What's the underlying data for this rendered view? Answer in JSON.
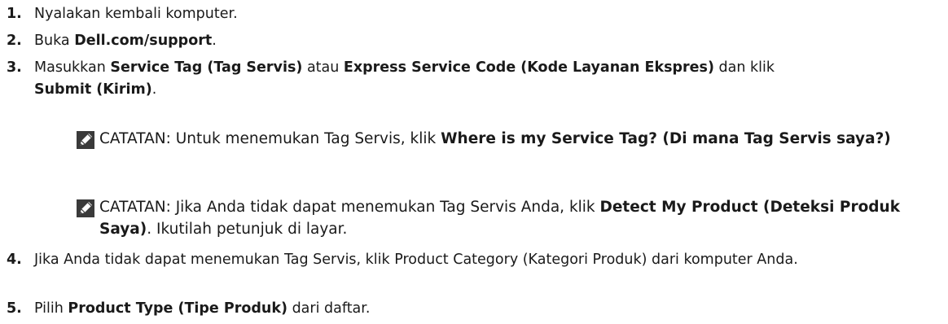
{
  "steps": [
    {
      "num": "1.",
      "parts": [
        {
          "t": "Nyalakan kembali komputer.",
          "b": false
        }
      ]
    },
    {
      "num": "2.",
      "parts": [
        {
          "t": "Buka ",
          "b": false
        },
        {
          "t": "Dell.com/support",
          "b": true
        },
        {
          "t": ".",
          "b": false
        }
      ]
    },
    {
      "num": "3.",
      "parts": [
        {
          "t": "Masukkan ",
          "b": false
        },
        {
          "t": "Service Tag (Tag Servis)",
          "b": true
        },
        {
          "t": " atau ",
          "b": false
        },
        {
          "t": "Express Service Code (Kode Layanan Ekspres)",
          "b": true
        },
        {
          "t": " dan klik ",
          "b": false
        },
        {
          "t": "Submit (Kirim)",
          "b": true
        },
        {
          "t": ".",
          "b": false
        }
      ]
    },
    {
      "num": "4.",
      "parts": [
        {
          "t": "Jika Anda tidak dapat menemukan Tag Servis, klik Product Category (Kategori Produk) dari komputer Anda.",
          "b": false
        }
      ]
    },
    {
      "num": "5.",
      "parts": [
        {
          "t": "Pilih ",
          "b": false
        },
        {
          "t": "Product Type (Tipe Produk)",
          "b": true
        },
        {
          "t": " dari daftar.",
          "b": false
        }
      ]
    }
  ],
  "notes": [
    {
      "label": "CATATAN:",
      "parts": [
        {
          "t": " Untuk menemukan Tag Servis, klik ",
          "b": false
        },
        {
          "t": "Where is my Service Tag? (Di mana Tag Servis saya?)",
          "b": true
        }
      ]
    },
    {
      "label": "CATATAN:",
      "parts": [
        {
          "t": " Jika Anda tidak dapat menemukan Tag Servis Anda, klik ",
          "b": false
        },
        {
          "t": "Detect My Product (Deteksi Produk Saya)",
          "b": true
        },
        {
          "t": ". Ikutilah petunjuk di layar.",
          "b": false
        }
      ]
    }
  ],
  "icons": {
    "note_icon": "pencil-note-icon"
  }
}
